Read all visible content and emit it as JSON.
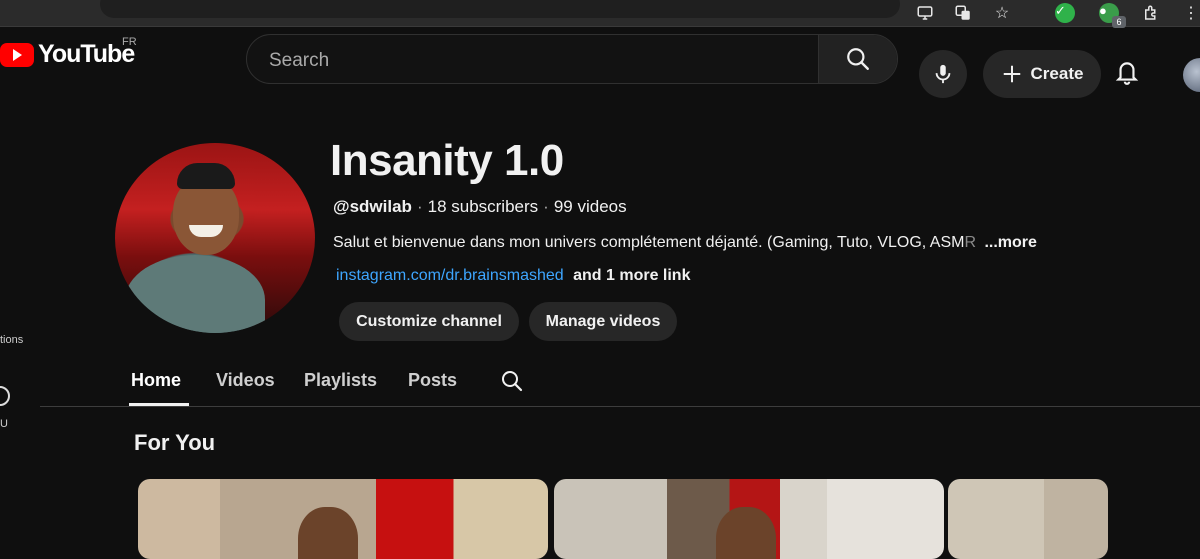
{
  "header": {
    "logo_text": "YouTube",
    "country_code": "FR",
    "search_placeholder": "Search",
    "create_label": "Create"
  },
  "sidebar": {
    "partial_labels": [
      "tions",
      "U"
    ]
  },
  "channel": {
    "name": "Insanity 1.0",
    "handle": "@sdwilab",
    "subscribers": "18 subscribers",
    "videos": "99 videos",
    "separator": "·",
    "description": "Salut et bienvenue dans mon univers complétement déjanté. (Gaming, Tuto, VLOG, ASM",
    "description_fade": "R",
    "more_label": "...more",
    "link_main": "instagram.com/dr.brainsmashed",
    "link_more": "and 1 more link",
    "buttons": {
      "customize": "Customize channel",
      "manage": "Manage videos"
    }
  },
  "tabs": [
    {
      "label": "Home",
      "active": true
    },
    {
      "label": "Videos",
      "active": false
    },
    {
      "label": "Playlists",
      "active": false
    },
    {
      "label": "Posts",
      "active": false
    }
  ],
  "section": {
    "title": "For You"
  },
  "browser": {
    "extension_badge": "6"
  },
  "colors": {
    "background": "#0f0f0f",
    "accent_red": "#ff0000",
    "link_blue": "#3ea6ff",
    "pill_bg": "#272727"
  },
  "icons": [
    "search-icon",
    "mic-icon",
    "plus-icon",
    "bell-icon",
    "avatar",
    "cast-icon",
    "translate-icon",
    "star-icon",
    "puzzle-icon"
  ]
}
